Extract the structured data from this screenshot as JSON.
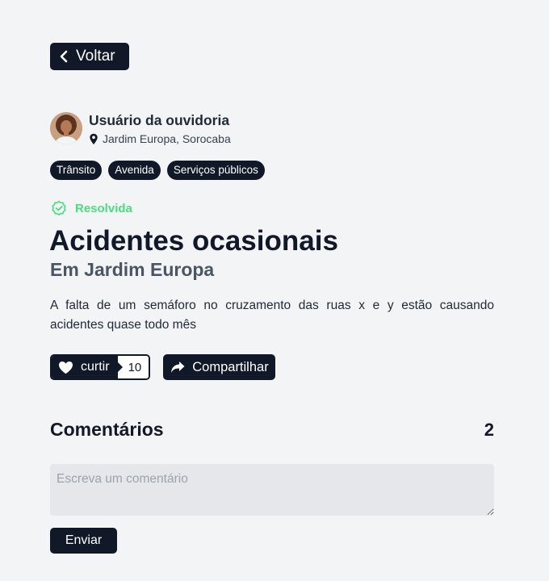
{
  "back_button": {
    "label": "Voltar",
    "icon": "chevron-left-icon"
  },
  "author": {
    "name": "Usuário da ouvidoria",
    "location": "Jardim Europa, Sorocaba",
    "location_icon": "map-pin-icon"
  },
  "tags": [
    "Trânsito",
    "Avenida",
    "Serviços públicos"
  ],
  "status": {
    "label": "Resolvida",
    "icon": "badge-check-icon",
    "color": "#4ade80"
  },
  "post": {
    "title": "Acidentes ocasionais",
    "subtitle": "Em Jardim Europa",
    "description": "A falta de um semáforo no cruzamento das ruas x e y estão causando acidentes quase todo mês"
  },
  "actions": {
    "like_label": "curtir",
    "like_count": "10",
    "like_icon": "heart-icon",
    "share_label": "Compartilhar",
    "share_icon": "share-icon"
  },
  "comments": {
    "title": "Comentários",
    "count": "2",
    "input_placeholder": "Escreva um comentário",
    "input_value": "",
    "send_label": "Enviar"
  },
  "colors": {
    "background": "#f3f4f6",
    "primary": "#111827",
    "success": "#4ade80",
    "input_bg": "#e5e7eb"
  }
}
